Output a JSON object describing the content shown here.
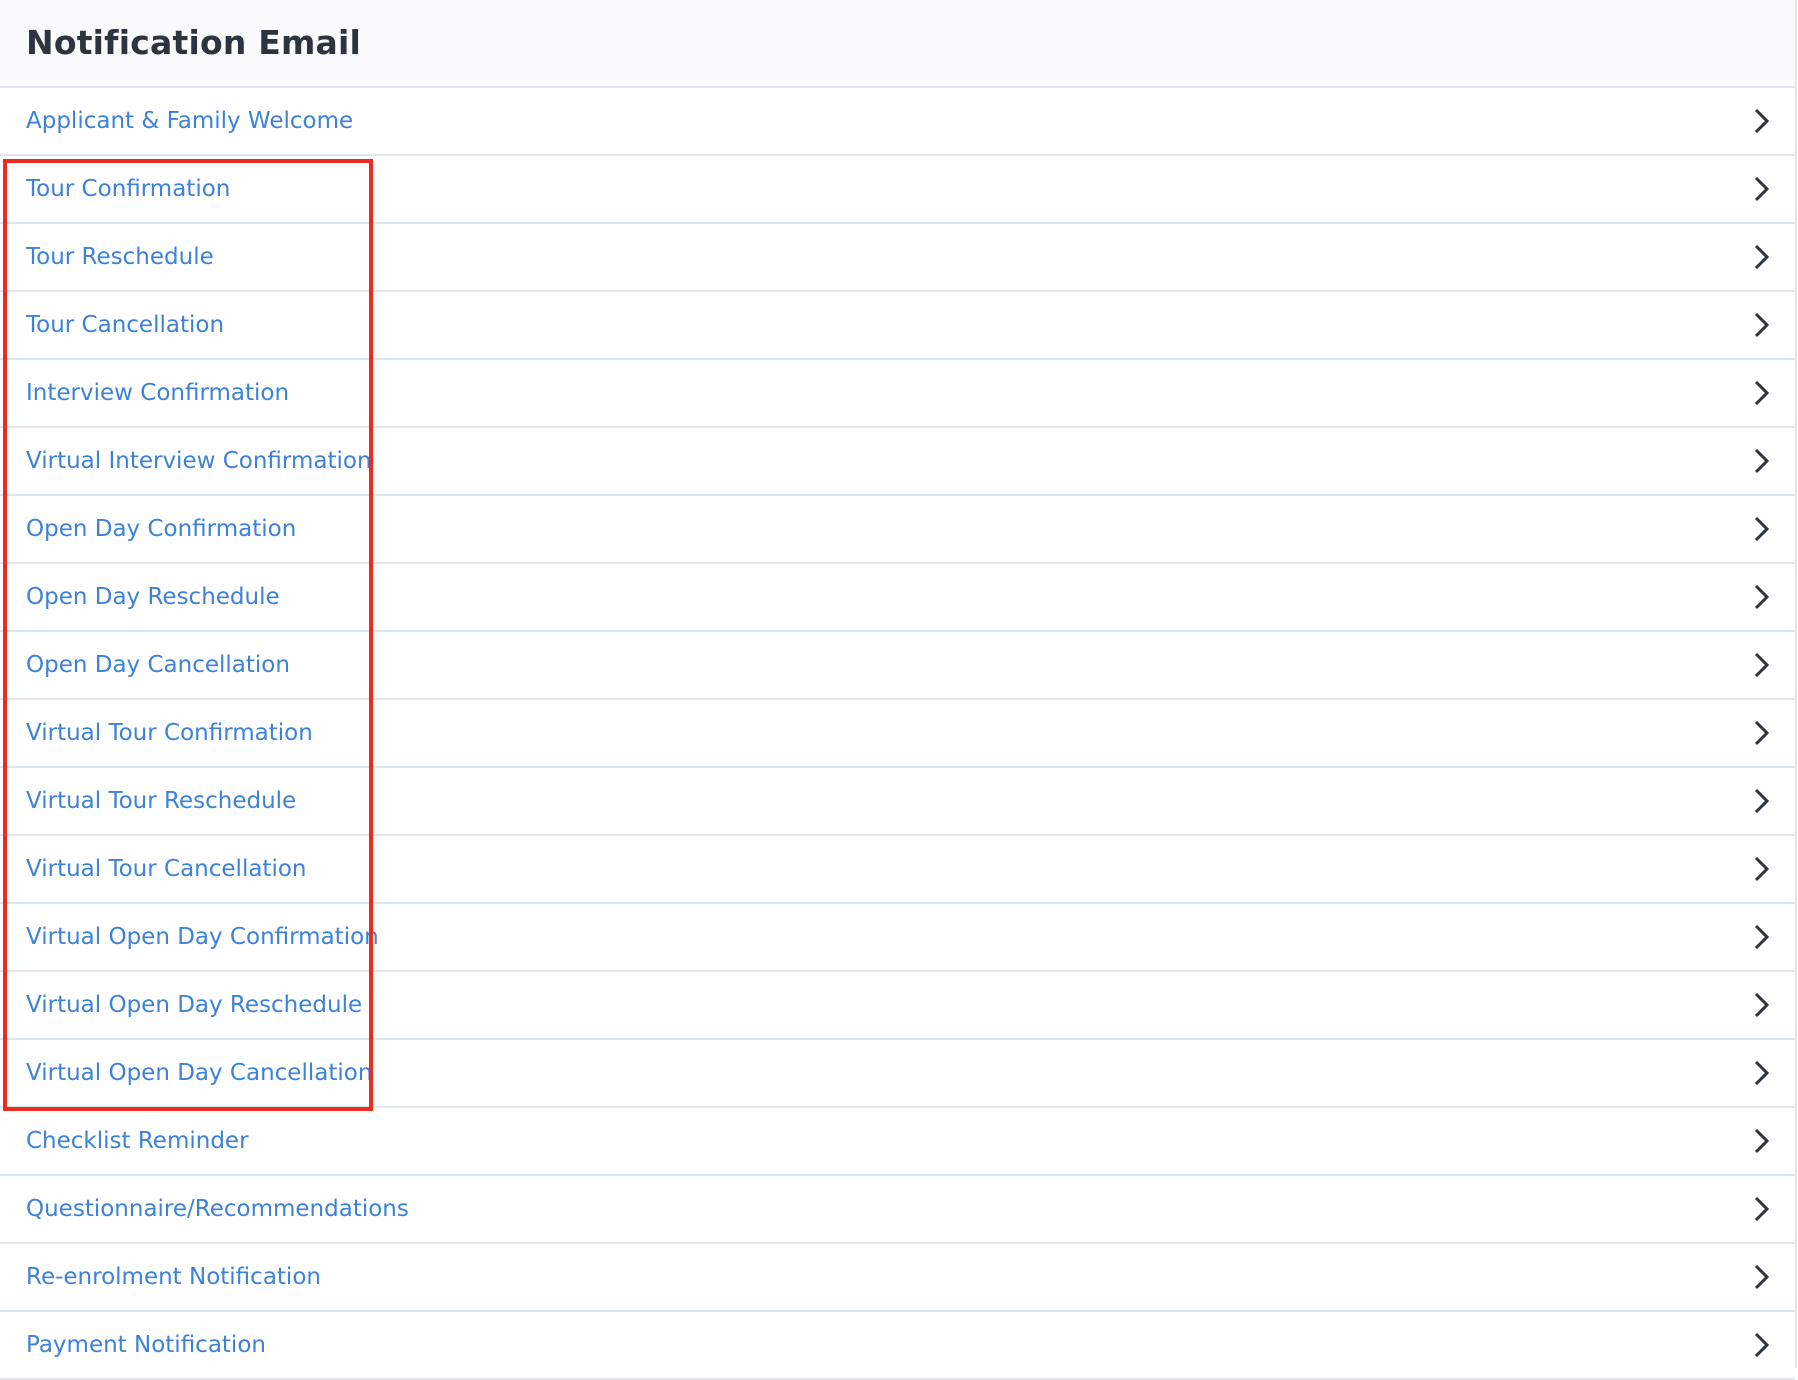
{
  "header": {
    "title": "Notification Email"
  },
  "items": [
    {
      "label": "Applicant & Family Welcome",
      "icon": "chevron-right-icon"
    },
    {
      "label": "Tour Confirmation",
      "icon": "chevron-right-icon"
    },
    {
      "label": "Tour Reschedule",
      "icon": "chevron-right-icon"
    },
    {
      "label": "Tour Cancellation",
      "icon": "chevron-right-icon"
    },
    {
      "label": "Interview Confirmation",
      "icon": "chevron-right-icon"
    },
    {
      "label": "Virtual Interview Confirmation",
      "icon": "chevron-right-icon"
    },
    {
      "label": "Open Day Confirmation",
      "icon": "chevron-right-icon"
    },
    {
      "label": "Open Day Reschedule",
      "icon": "chevron-right-icon"
    },
    {
      "label": "Open Day Cancellation",
      "icon": "chevron-right-icon"
    },
    {
      "label": "Virtual Tour Confirmation",
      "icon": "chevron-right-icon"
    },
    {
      "label": "Virtual Tour Reschedule",
      "icon": "chevron-right-icon"
    },
    {
      "label": "Virtual Tour Cancellation",
      "icon": "chevron-right-icon"
    },
    {
      "label": "Virtual Open Day Confirmation",
      "icon": "chevron-right-icon"
    },
    {
      "label": "Virtual Open Day Reschedule",
      "icon": "chevron-right-icon"
    },
    {
      "label": "Virtual Open Day Cancellation",
      "icon": "chevron-right-icon"
    },
    {
      "label": "Checklist Reminder",
      "icon": "chevron-right-icon"
    },
    {
      "label": "Questionnaire/Recommendations",
      "icon": "chevron-right-icon"
    },
    {
      "label": "Re-enrolment Notification",
      "icon": "chevron-right-icon"
    },
    {
      "label": "Payment Notification",
      "icon": "chevron-right-icon"
    }
  ],
  "highlight": {
    "color": "#ee2b1f",
    "first_item": "Tour Confirmation",
    "last_item": "Virtual Open Day Cancellation"
  },
  "colors": {
    "link": "#3d82d8",
    "title": "#2c3440",
    "header_bg": "#f8fafc",
    "divider": "#dde5ee",
    "chevron": "#2c3440"
  }
}
